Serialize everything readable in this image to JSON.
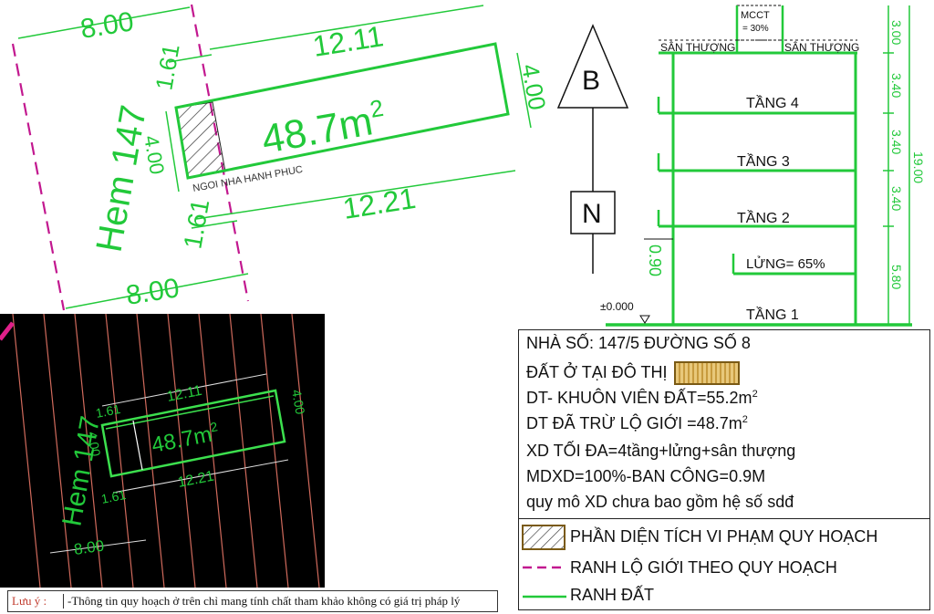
{
  "plan_top": {
    "alley_label": "Hem 147",
    "frontage_top": "8.00",
    "frontage_bottom": "8.00",
    "top_length": "12.11",
    "bottom_length": "12.21",
    "setback_top": "1.61",
    "setback_bottom": "1.61",
    "right_width": "4.00",
    "left_width": "4.00",
    "area": "48.7m",
    "area_sup": "2",
    "house_note": "NGOI NHA HANH PHUC"
  },
  "compass": {
    "north": "B",
    "south": "N"
  },
  "section": {
    "mcct_line1": "MCCT",
    "mcct_line2": "= 30%",
    "roof_left": "SÂN THƯỢNG",
    "roof_right": "SÂN THƯỢNG",
    "floor4": "TẦNG 4",
    "floor3": "TẦNG 3",
    "floor2": "TẦNG 2",
    "mezzanine": "LỬNG= 65%",
    "floor1": "TẦNG 1",
    "balcony": "0.90",
    "ground": "±0.000",
    "h_roof": "3.00",
    "h4": "3.40",
    "h3": "3.40",
    "h2": "3.40",
    "h1": "5.80",
    "h_total": "19.00"
  },
  "inset": {
    "alley_label": "Hem 147",
    "top_length": "12.11",
    "bottom_length": "12.21",
    "setback_top": "1.61",
    "setback_bottom": "1.61",
    "left_width": "4.00",
    "right_width": "4.00",
    "area": "48.7m",
    "area_sup": "2",
    "frontage": "8.00"
  },
  "info": {
    "address": "NHÀ SỐ: 147/5 ĐƯỜNG SỐ 8",
    "land_type": "ĐẤT Ở TẠI ĐÔ THỊ",
    "site_area": "DT- KHUÔN VIÊN ĐẤT=55.2m",
    "site_area_sup": "2",
    "net_area": "DT ĐÃ TRỪ LỘ GIỚI =48.7m",
    "net_area_sup": "2",
    "max_build": "XD TỐI ĐA=4tầng+lửng+sân thượng",
    "density": "MDXD=100%-BAN CÔNG=0.9M",
    "scale_note": "quy mô XD chưa bao gồm hệ số sdđ"
  },
  "legend": {
    "violation": "PHẦN DIỆN TÍCH VI PHẠM QUY HOẠCH",
    "road_line": "RANH LỘ GIỚI THEO QUY HOẠCH",
    "lot_line": "RANH ĐẤT"
  },
  "note": {
    "label": "Lưu ý :",
    "text": "-Thông tin quy hoạch ở trên chỉ mang tính chất tham khảo không có giá trị pháp lý"
  },
  "colors": {
    "lot_line": "#22c93a",
    "road_line": "#c2188f",
    "inset_bg": "#000000",
    "inset_grid": "#d06a5c"
  }
}
